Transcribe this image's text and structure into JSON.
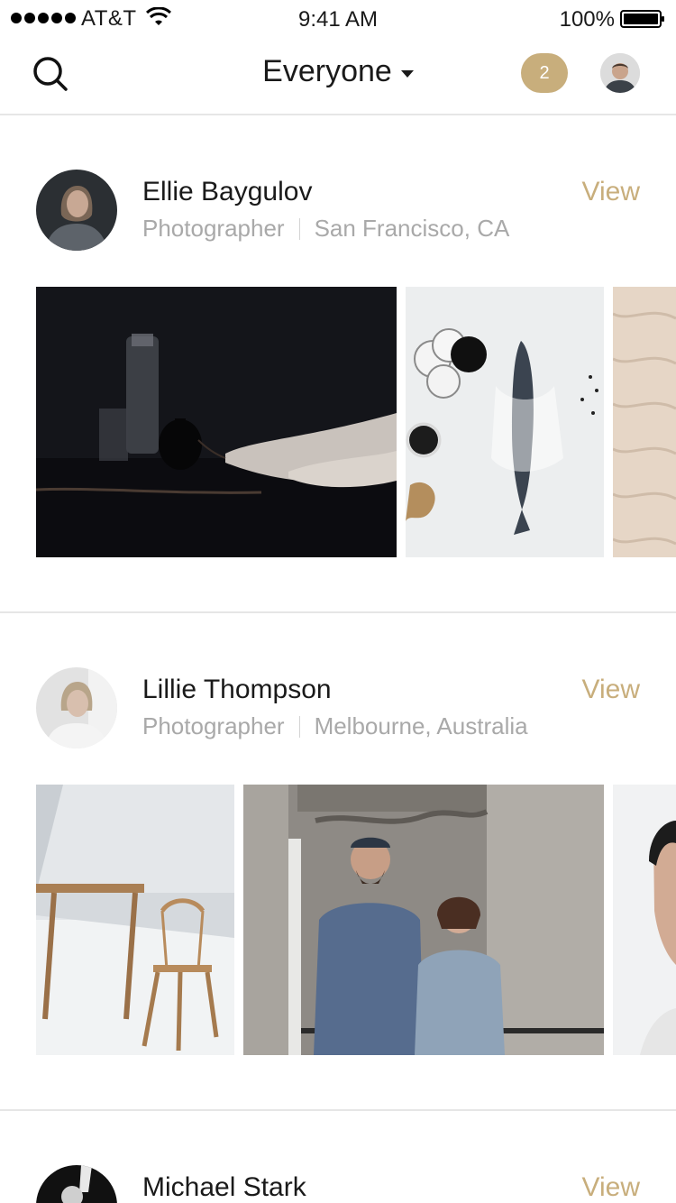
{
  "status_bar": {
    "carrier": "AT&T",
    "time": "9:41 AM",
    "battery": "100%"
  },
  "nav": {
    "title": "Everyone",
    "notification_count": "2"
  },
  "colors": {
    "accent": "#c8ae7c",
    "text_primary": "#1a1a1a",
    "text_secondary": "#a9a9a9",
    "divider": "#e6e6e6"
  },
  "profiles": [
    {
      "name": "Ellie Baygulov",
      "role": "Photographer",
      "location": "San Francisco, CA",
      "action": "View"
    },
    {
      "name": "Lillie Thompson",
      "role": "Photographer",
      "location": "Melbourne, Australia",
      "action": "View"
    },
    {
      "name": "Michael Stark",
      "action": "View"
    }
  ]
}
